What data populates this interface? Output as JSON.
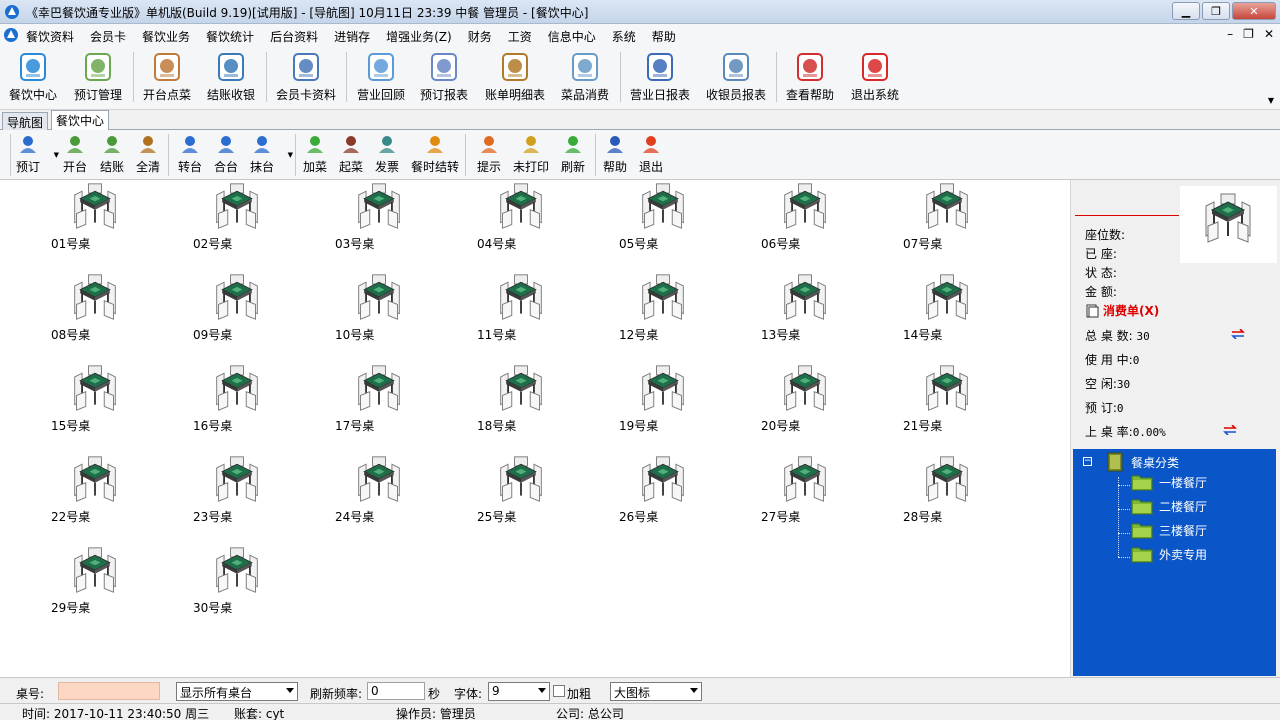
{
  "window": {
    "title": "《幸巴餐饮通专业版》单机版(Build 9.19)[试用版] - [导航图]  10月11日 23:39 中餐 管理员 - [餐饮中心]"
  },
  "menu": {
    "items": [
      "餐饮资料",
      "会员卡",
      "餐饮业务",
      "餐饮统计",
      "后台资料",
      "进销存",
      "增强业务(Z)",
      "财务",
      "工资",
      "信息中心",
      "系统",
      "帮助"
    ]
  },
  "main_toolbar": {
    "items": [
      {
        "label": "餐饮中心",
        "icon": "dining-center-icon"
      },
      {
        "label": "预订管理",
        "icon": "booking-icon"
      },
      {
        "label": "开台点菜",
        "icon": "house-icon"
      },
      {
        "label": "结账收银",
        "icon": "cashier-icon"
      },
      {
        "label": "会员卡资料",
        "icon": "member-card-icon"
      },
      {
        "label": "营业回顾",
        "icon": "review-icon"
      },
      {
        "label": "预订报表",
        "icon": "report-icon"
      },
      {
        "label": "账单明细表",
        "icon": "ledger-icon"
      },
      {
        "label": "菜品消费",
        "icon": "dish-icon"
      },
      {
        "label": "营业日报表",
        "icon": "daily-report-icon"
      },
      {
        "label": "收银员报表",
        "icon": "magnifier-icon"
      },
      {
        "label": "查看帮助",
        "icon": "help-icon"
      },
      {
        "label": "退出系统",
        "icon": "power-icon"
      }
    ]
  },
  "tabs": [
    "导航图",
    "餐饮中心"
  ],
  "sub_toolbar": {
    "items": [
      {
        "label": "预订",
        "icon": "user-icon",
        "color": "#2a6ccf"
      },
      {
        "label": "开台",
        "icon": "open-table-icon",
        "color": "#4a9a3a"
      },
      {
        "label": "结账",
        "icon": "checkout-icon",
        "color": "#4a9a3a"
      },
      {
        "label": "全清",
        "icon": "broom-icon",
        "color": "#b07020"
      },
      {
        "label": "转台",
        "icon": "transfer-icon",
        "color": "#2a6ccf"
      },
      {
        "label": "合台",
        "icon": "merge-icon",
        "color": "#2a6ccf"
      },
      {
        "label": "抹台",
        "icon": "wipe-icon",
        "color": "#2a6ccf"
      },
      {
        "label": "加菜",
        "icon": "add-dish-icon",
        "color": "#3aaa3a"
      },
      {
        "label": "起菜",
        "icon": "book-icon",
        "color": "#8a3a2a"
      },
      {
        "label": "发票",
        "icon": "invoice-icon",
        "color": "#3a8a8a"
      },
      {
        "label": "餐时结转",
        "icon": "clock-icon",
        "color": "#e08a10"
      },
      {
        "label": "提示",
        "icon": "chat-icon",
        "color": "#e06a20"
      },
      {
        "label": "未打印",
        "icon": "pencil-icon",
        "color": "#d0a020"
      },
      {
        "label": "刷新",
        "icon": "refresh-icon",
        "color": "#3aaa3a"
      },
      {
        "label": "帮助",
        "icon": "question-icon",
        "color": "#2a5ab8"
      },
      {
        "label": "退出",
        "icon": "x-icon",
        "color": "#e04020"
      }
    ]
  },
  "tables": [
    "01号桌",
    "02号桌",
    "03号桌",
    "04号桌",
    "05号桌",
    "06号桌",
    "07号桌",
    "08号桌",
    "09号桌",
    "10号桌",
    "11号桌",
    "12号桌",
    "13号桌",
    "14号桌",
    "15号桌",
    "16号桌",
    "17号桌",
    "18号桌",
    "19号桌",
    "20号桌",
    "21号桌",
    "22号桌",
    "23号桌",
    "24号桌",
    "25号桌",
    "26号桌",
    "27号桌",
    "28号桌",
    "29号桌",
    "30号桌"
  ],
  "info": {
    "seats_label": "座位数:",
    "seated_label": "已  座:",
    "status_label": "状  态:",
    "amount_label": "金  额:",
    "bill_label": "消费单(X)",
    "total_label": "总 桌 数:",
    "total_value": "30",
    "in_use_label": "使 用 中:",
    "in_use_value": "0",
    "idle_label": "空    闲:",
    "idle_value": "30",
    "reserved_label": "预    订:",
    "reserved_value": "0",
    "rate_label": "上 桌 率:",
    "rate_value": "0.00%"
  },
  "tree": {
    "root": "餐桌分类",
    "children": [
      "一楼餐厅",
      "二楼餐厅",
      "三楼餐厅",
      "外卖专用"
    ]
  },
  "controls": {
    "table_no_label": "桌号:",
    "table_no_value": "",
    "filter_value": "显示所有桌台",
    "refresh_label": "刷新频率:",
    "refresh_value": "0",
    "seconds_label": "秒",
    "font_label": "字体:",
    "font_value": "9",
    "bold_label": "加粗",
    "view_value": "大图标"
  },
  "status": {
    "time": "时间: 2017-10-11 23:40:50 周三",
    "account": "账套: cyt",
    "operator": "操作员: 管理员",
    "company": "公司: 总公司"
  },
  "colors": {
    "tree_bg": "#0a56c8",
    "table_top": "#1e6e4a",
    "bill_red": "#dd0000"
  }
}
